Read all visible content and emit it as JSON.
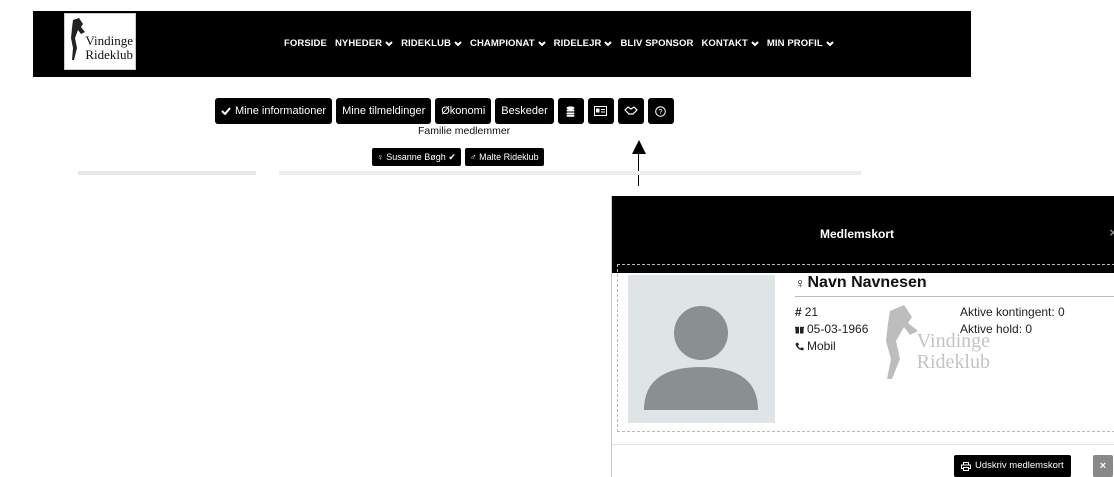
{
  "logo": {
    "line1": "Vindinge",
    "line2": "Rideklub"
  },
  "nav": {
    "items": [
      {
        "label": "FORSIDE",
        "dropdown": false
      },
      {
        "label": "NYHEDER",
        "dropdown": true
      },
      {
        "label": "RIDEKLUB",
        "dropdown": true
      },
      {
        "label": "CHAMPIONAT",
        "dropdown": true
      },
      {
        "label": "RIDELEJR",
        "dropdown": true
      },
      {
        "label": "BLIV SPONSOR",
        "dropdown": false
      },
      {
        "label": "KONTAKT",
        "dropdown": true
      },
      {
        "label": "MIN PROFIL",
        "dropdown": true
      }
    ]
  },
  "tabs": {
    "info": "Mine informationer",
    "signups": "Mine tilmeldinger",
    "economy": "Økonomi",
    "messages": "Beskeder",
    "icons": [
      "database-icon",
      "id-card-icon",
      "handshake-icon",
      "help-icon"
    ]
  },
  "family": {
    "label": "Familie medlemmer",
    "members": [
      "Susanne Bøgh",
      "Malte Rideklub"
    ]
  },
  "modal": {
    "title": "Medlemskort",
    "close_symbol": "×",
    "name": "Navn Navnesen",
    "number": "21",
    "birthdate": "05-03-1966",
    "phone": "Mobil",
    "active_subscription": "Aktive kontingent: 0",
    "active_teams": "Aktive hold: 0",
    "watermark_line1": "Vindinge",
    "watermark_line2": "Rideklub",
    "print_label": "Udskriv medlemskort",
    "close_button": "×"
  },
  "colors": {
    "bar": "#000000",
    "photo_bg": "#dfe4e7",
    "avatar": "#8a8f92"
  }
}
